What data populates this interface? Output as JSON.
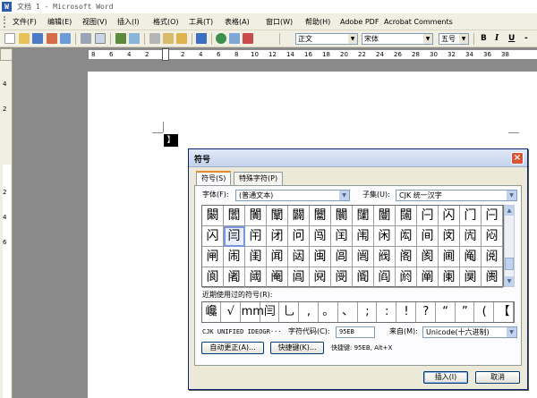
{
  "window": {
    "title": "文档 1 - Microsoft Word",
    "logo": "W"
  },
  "menu": [
    "文件(F)",
    "编辑(E)",
    "视图(V)",
    "插入(I)",
    "格式(O)",
    "工具(T)",
    "表格(A)",
    "窗口(W)",
    "帮助(H)",
    "Adobe PDF",
    "Acrobat Comments"
  ],
  "toolbar": {
    "style_value": "正文",
    "font_value": "宋体",
    "size_value": "五号",
    "bold_label": "B",
    "italic_label": "I",
    "underline_label": "U",
    "more_label": "-"
  },
  "ruler": {
    "h_labels": [
      "8",
      "6",
      "4",
      "2",
      "2",
      "4",
      "6",
      "8",
      "10",
      "12",
      "14",
      "16",
      "18",
      "20",
      "22",
      "24",
      "26",
      "28",
      "30",
      "32",
      "34",
      "36",
      "38"
    ],
    "v_labels": [
      "4",
      "2",
      "2",
      "4",
      "6"
    ]
  },
  "document": {
    "cursor_glyph": "】"
  },
  "dialog": {
    "title": "符号",
    "close_label": "×",
    "tabs": [
      "符号(S)",
      "特殊字符(P)"
    ],
    "font_label": "字体(F):",
    "font_value": "(普通文本)",
    "subset_label": "子集(U):",
    "subset_value": "CJK 统一汉字",
    "grid_rows": [
      [
        "闞",
        "闟",
        "闠",
        "闡",
        "闢",
        "闣",
        "闤",
        "闥",
        "闦",
        "闧",
        "闩",
        "闪",
        "门",
        "闩"
      ],
      [
        "闪",
        "闫",
        "闬",
        "闭",
        "问",
        "闯",
        "闰",
        "闱",
        "闲",
        "闳",
        "间",
        "闵",
        "闶",
        "闷"
      ],
      [
        "闸",
        "闹",
        "闺",
        "闻",
        "闼",
        "闽",
        "闾",
        "闿",
        "阀",
        "阁",
        "阂",
        "阃",
        "阄",
        "阅"
      ],
      [
        "阆",
        "阇",
        "阈",
        "阉",
        "阊",
        "阋",
        "阌",
        "阍",
        "阎",
        "阏",
        "阐",
        "阑",
        "阒",
        "阓"
      ]
    ],
    "recent_label": "近期使用过的符号(R):",
    "recent_symbols": [
      "巉",
      "√",
      "mm",
      "闫",
      "乚",
      ",",
      "。",
      "、",
      ";",
      ":",
      "!",
      "?",
      "“",
      "”",
      "(",
      "【"
    ],
    "char_name": "CJK UNIFIED IDEOGR···",
    "charcode_label": "字符代码(C):",
    "charcode_value": "95EB",
    "from_label": "来自(M):",
    "from_value": "Unicode(十六进制)",
    "autocorrect_label": "自动更正(A)...",
    "shortcut_btn_label": "快捷键(K)...",
    "shortcut_text": "快捷键: 95EB, Alt+X",
    "insert_label": "插入(I)",
    "cancel_label": "取消"
  },
  "colors": {
    "titlebar_accent": "#2a5caa",
    "dialog_close": "#d9553a",
    "tab_active_accent": "#e68b2c"
  }
}
